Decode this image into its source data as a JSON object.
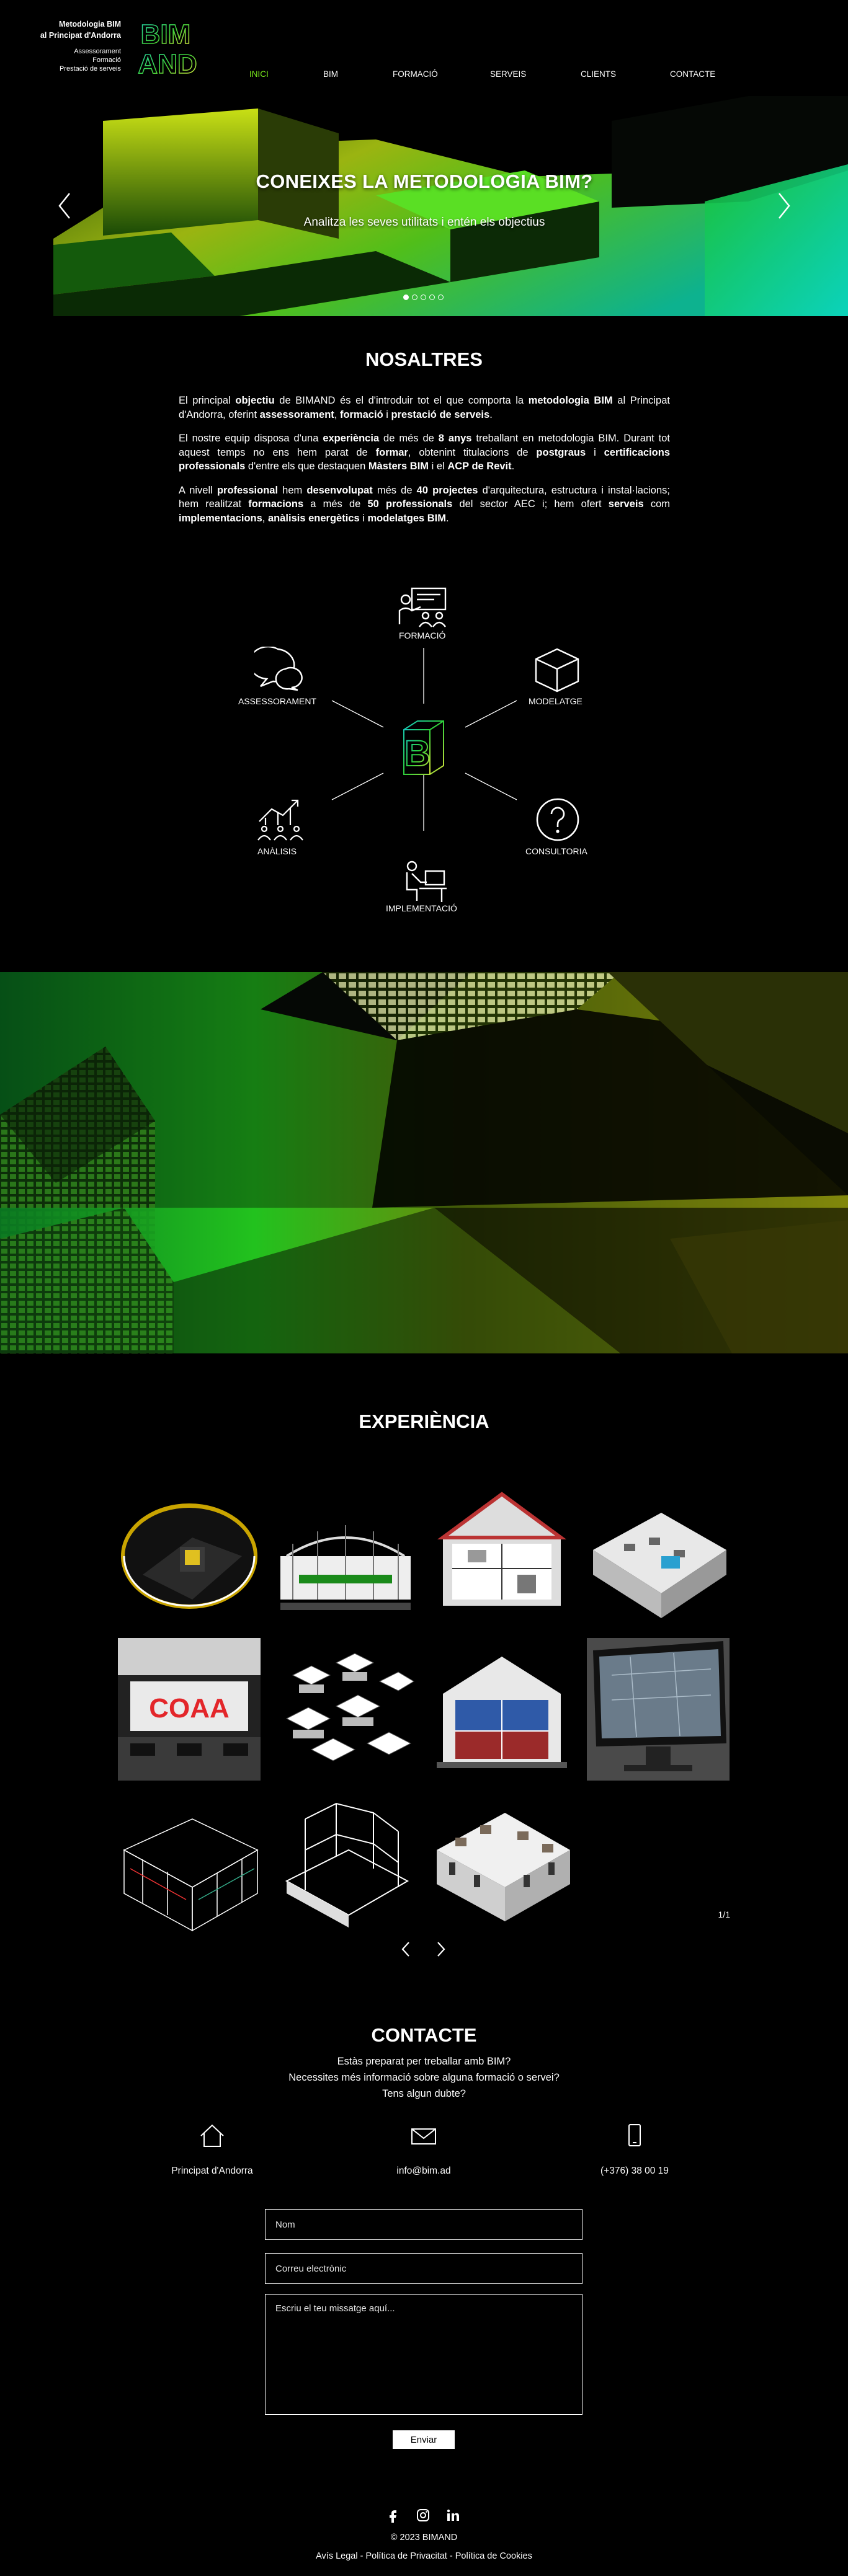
{
  "header": {
    "brand_title_1": "Metodologia BIM",
    "brand_title_2": "al Principat d'Andorra",
    "brand_sub_1": "Assessorament",
    "brand_sub_2": "Formació",
    "brand_sub_3": "Prestació de serveis",
    "logo_text_1": "BIM",
    "logo_text_2": "AND",
    "nav": [
      {
        "label": "INICI",
        "active": true
      },
      {
        "label": "BIM"
      },
      {
        "label": "FORMACIÓ"
      },
      {
        "label": "SERVEIS"
      },
      {
        "label": "CLIENTS"
      },
      {
        "label": "CONTACTE"
      }
    ],
    "active_color": "#7cf01c"
  },
  "hero": {
    "title": "CONEIXES LA METODOLOGIA BIM?",
    "subtitle": "Analitza les seves utilitats i entén els objectius",
    "slides_total": 5,
    "slide_active": 1
  },
  "about": {
    "title": "NOSALTRES",
    "p1": [
      {
        "t": "El principal "
      },
      {
        "b": "objectiu"
      },
      {
        "t": " de BIMAND és el d'introduir tot el que comporta la "
      },
      {
        "b": "metodologia BIM"
      },
      {
        "t": " al Principat d'Andorra, oferint "
      },
      {
        "b": "assessorament"
      },
      {
        "t": ", "
      },
      {
        "b": "formació"
      },
      {
        "t": " i "
      },
      {
        "b": "prestació de serveis"
      },
      {
        "t": "."
      }
    ],
    "p2": [
      {
        "t": "El nostre equip disposa d'una "
      },
      {
        "b": "experiència"
      },
      {
        "t": " de més de "
      },
      {
        "b": "8 anys"
      },
      {
        "t": " treballant en metodologia BIM. Durant tot aquest temps no ens hem parat de "
      },
      {
        "b": "formar"
      },
      {
        "t": ", obtenint titulacions de "
      },
      {
        "b": "postgraus"
      },
      {
        "t": " i "
      },
      {
        "b": "certificacions professionals"
      },
      {
        "t": " d'entre els que destaquen "
      },
      {
        "b": "Màsters BIM"
      },
      {
        "t": " i el "
      },
      {
        "b": "ACP de Revit"
      },
      {
        "t": "."
      }
    ],
    "p3": [
      {
        "t": "A nivell "
      },
      {
        "b": "professional"
      },
      {
        "t": " hem "
      },
      {
        "b": "desenvolupat"
      },
      {
        "t": " més de "
      },
      {
        "b": "40 projectes"
      },
      {
        "t": " d'arquitectura, estructura i instal·lacions; hem realitzat "
      },
      {
        "b": "formacions"
      },
      {
        "t": " a més de "
      },
      {
        "b": "50 professionals"
      },
      {
        "t": " del sector AEC i; hem ofert "
      },
      {
        "b": "serveis"
      },
      {
        "t": " com "
      },
      {
        "b": "implementacions"
      },
      {
        "t": ", "
      },
      {
        "b": "anàlisis energètics"
      },
      {
        "t": " i "
      },
      {
        "b": "modelatges BIM"
      },
      {
        "t": "."
      }
    ]
  },
  "diagram": {
    "center_letter": "B",
    "nodes": {
      "formacio": "FORMACIÓ",
      "assessorament": "ASSESSORAMENT",
      "modelatge": "MODELATGE",
      "analisis": "ANÀLISIS",
      "consultoria": "CONSULTORIA",
      "implementacio": "IMPLEMENTACIÓ"
    },
    "icon_names": [
      "presentation-icon",
      "chat-bubbles-icon",
      "cube-icon",
      "people-chart-icon",
      "question-circle-icon",
      "desk-worker-icon"
    ]
  },
  "experience": {
    "title": "EXPERIÈNCIA",
    "tiles": [
      "round-render",
      "stadium",
      "house-section",
      "iso-building",
      "coaa-hall",
      "iso-blocks",
      "house-section-2",
      "monitor",
      "iso-frame",
      "iso-structure",
      "iso-apartments"
    ],
    "pager": "1/1",
    "prev_icon": "chevron-left-icon",
    "next_icon": "chevron-right-icon",
    "coaa_text": "COAA"
  },
  "contact": {
    "title": "CONTACTE",
    "line1": "Estàs preparat per treballar amb BIM?",
    "line2": "Necessites més informació sobre alguna formació o servei?",
    "line3": "Tens algun dubte?",
    "location": "Principat d'Andorra",
    "email": "info@bim.ad",
    "phone": "(+376) 38 00 19",
    "name_placeholder": "Nom",
    "email_placeholder": "Correu electrònic",
    "message_placeholder": "Escriu el teu missatge aquí...",
    "send_label": "Enviar"
  },
  "footer": {
    "socials": [
      "facebook-icon",
      "instagram-icon",
      "linkedin-icon"
    ],
    "copyright": "© 2023 BIMAND",
    "legal": "Avís Legal - Política de Privacitat - Política de Cookies"
  }
}
